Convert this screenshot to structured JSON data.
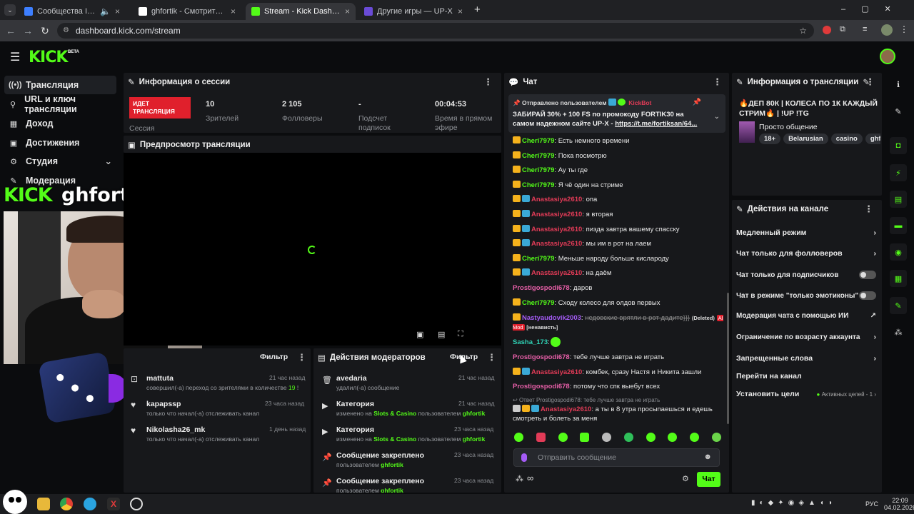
{
  "browser": {
    "tabs": [
      {
        "title": "Сообщества Ivan Osobov",
        "color": "#3d7fff"
      },
      {
        "title": "ghfortik - Смотрите в Лайве на...",
        "color": "#ffffff"
      },
      {
        "title": "Stream - Kick Dashboard",
        "color": "#53fc18"
      },
      {
        "title": "Другие игры — UP-X",
        "color": "#6a4bd6"
      }
    ],
    "new_tab": "+",
    "url": "dashboard.kick.com/stream"
  },
  "kick": {
    "logo": "KICK",
    "beta": "BETA"
  },
  "sidebar": {
    "items": [
      {
        "label": "Трансляция",
        "icon": "broadcast-icon"
      },
      {
        "label": "URL и ключ трансляции",
        "icon": "key-icon"
      },
      {
        "label": "Доход",
        "icon": "income-icon"
      },
      {
        "label": "Достижения",
        "icon": "trophy-icon"
      },
      {
        "label": "Студия",
        "icon": "studio-icon"
      },
      {
        "label": "Модерация",
        "icon": "wrench-icon"
      }
    ]
  },
  "overlay": {
    "brand": "KICK",
    "channel": "ghfortik"
  },
  "session": {
    "title": "Информация о сессии",
    "live_badge": "ИДЕТ ТРАНСЛЯЦИЯ",
    "session_label": "Сессия",
    "stats": [
      {
        "value": "10",
        "label": "Зрителей"
      },
      {
        "value": "2 105",
        "label": "Фолловеры"
      },
      {
        "value": "-",
        "label": "Подсчет подписок"
      },
      {
        "value": "00:04:53",
        "label": "Время в прямом эфире"
      }
    ]
  },
  "preview": {
    "title": "Предпросмотр трансляции"
  },
  "activity": {
    "filter": "Фильтр",
    "items": [
      {
        "name": "mattuta",
        "sub": "совершил(-а) переход со зрителями в количестве",
        "count": "19",
        "tail": "!",
        "time": "21 час назад"
      },
      {
        "name": "kapapssp",
        "sub": "только что начал(-а) отслеживать канал",
        "time": "23 часа назад"
      },
      {
        "name": "Nikolasha26_mk",
        "sub": "только что начал(-а) отслеживать канал",
        "time": "1 день назад"
      }
    ]
  },
  "modactions": {
    "title": "Действия модераторов",
    "filter": "Фильтр",
    "items": [
      {
        "name": "avedaria",
        "sub": "удалил(-а) сообщение",
        "time": "21 час назад"
      },
      {
        "name": "Категория",
        "sub": "изменено на",
        "hl": "Slots & Casino",
        "sub2": "пользователем",
        "user": "ghfortik",
        "time": "21 час назад"
      },
      {
        "name": "Категория",
        "sub": "изменено на",
        "hl": "Slots & Casino",
        "sub2": "пользователем",
        "user": "ghfortik",
        "time": "23 часа назад"
      },
      {
        "name": "Сообщение закреплено",
        "sub": "пользователем",
        "user": "ghfortik",
        "time": "23 часа назад"
      },
      {
        "name": "Сообщение закреплено",
        "sub": "пользователем",
        "user": "ghfortik",
        "time": "23 часа назад"
      }
    ]
  },
  "chat": {
    "title": "Чат",
    "pinned_by": "Отправлено пользователем",
    "pinned_user": "KickBot",
    "pinned_text": "ЗАБИРАЙ 30% + 100 FS по промокоду FORTIK30 на самом надежном сайте UP-X - ",
    "pinned_link": "https://t.me/fortiksan/64...",
    "messages": [
      {
        "user": "Cheri7979",
        "c": "u-g",
        "text": "Есть немного времени",
        "crown": true,
        "blue": false
      },
      {
        "user": "Cheri7979",
        "c": "u-g",
        "text": "Пока посмотрю",
        "crown": true,
        "blue": false
      },
      {
        "user": "Cheri7979",
        "c": "u-g",
        "text": "Ау ты где",
        "crown": true,
        "blue": false
      },
      {
        "user": "Cheri7979",
        "c": "u-g",
        "text": "Я чё один на стриме",
        "crown": true,
        "blue": false
      },
      {
        "user": "Anastasiya2610",
        "c": "u-r",
        "text": "опа",
        "crown": true,
        "blue": true
      },
      {
        "user": "Anastasiya2610",
        "c": "u-r",
        "text": "я вторая",
        "crown": true,
        "blue": true
      },
      {
        "user": "Anastasiya2610",
        "c": "u-r",
        "text": "пизда завтра вашему спасску",
        "crown": true,
        "blue": true
      },
      {
        "user": "Anastasiya2610",
        "c": "u-r",
        "text": "мы им в рот на лаем",
        "crown": true,
        "blue": true
      },
      {
        "user": "Cheri7979",
        "c": "u-g",
        "text": "Меньше народу больше кислароду",
        "crown": true,
        "blue": false
      },
      {
        "user": "Anastasiya2610",
        "c": "u-r",
        "text": "на даём",
        "crown": true,
        "blue": true
      },
      {
        "user": "Prostigospodi678",
        "c": "u-p",
        "text": "даров",
        "crown": false,
        "blue": false
      },
      {
        "user": "Cheri7979",
        "c": "u-g",
        "text": "Сходу колесо для олдов первых",
        "crown": true,
        "blue": false
      }
    ],
    "deleted": {
      "user": "Nastyaudovik2003",
      "text": "недовские врятли в рот дадите}}}",
      "deleted_label": "(Deleted)",
      "ai": "AI Mod",
      "reason": "[ненависть]"
    },
    "messages2": [
      {
        "user": "Sasha_173",
        "c": "u-t",
        "text": "",
        "crown": false,
        "blue": false
      },
      {
        "user": "Prostigospodi678",
        "c": "u-p",
        "text": "тебе лучше завтра не играть",
        "crown": false,
        "blue": false
      },
      {
        "user": "Anastasiya2610",
        "c": "u-r",
        "text": "комбек, сразу Настя и Никита зашли",
        "crown": true,
        "blue": true
      },
      {
        "user": "Prostigospodi678",
        "c": "u-p",
        "text": "потому что спк выебут всех",
        "crown": false,
        "blue": false
      }
    ],
    "reply_to": "Ответ Prostigospodi678: тебе лучше завтра не играть",
    "reply": {
      "user": "Anastasiya2610",
      "text": "а ты в 8 утра просыпаешься и едешь смотреть и болеть за меня"
    },
    "input_placeholder": "Отправить сообщение",
    "send": "Чат",
    "infinity": "∞"
  },
  "stream_info": {
    "title": "Информация о трансляции",
    "stream_title": "🔥ДЕП 80К | КОЛЕСА ПО 1К КАЖДЫЙ СТРИМ🔥 | !UP !TG",
    "category": "Просто общение",
    "tags": [
      "18+",
      "Belarusian",
      "casino",
      "ghfo"
    ]
  },
  "channel_actions": {
    "title": "Действия на канале",
    "items": [
      {
        "label": "Медленный режим",
        "type": "chevron"
      },
      {
        "label": "Чат только для фолловеров",
        "type": "chevron"
      },
      {
        "label": "Чат только для подписчиков",
        "type": "toggle"
      },
      {
        "label": "Чат в режиме \"только эмотиконы\"",
        "type": "toggle"
      },
      {
        "label": "Модерация чата с помощью ИИ",
        "type": "external"
      },
      {
        "label": "Ограничение по возрасту аккаунта",
        "type": "chevron"
      },
      {
        "label": "Запрещенные слова",
        "type": "chevron"
      },
      {
        "label": "Перейти на канал",
        "type": "none"
      }
    ],
    "goals": {
      "label": "Установить цели",
      "status": "Активных целей - 1"
    }
  },
  "taskbar": {
    "lang": "РУС",
    "time": "22:09",
    "date": "04.02.2026"
  }
}
